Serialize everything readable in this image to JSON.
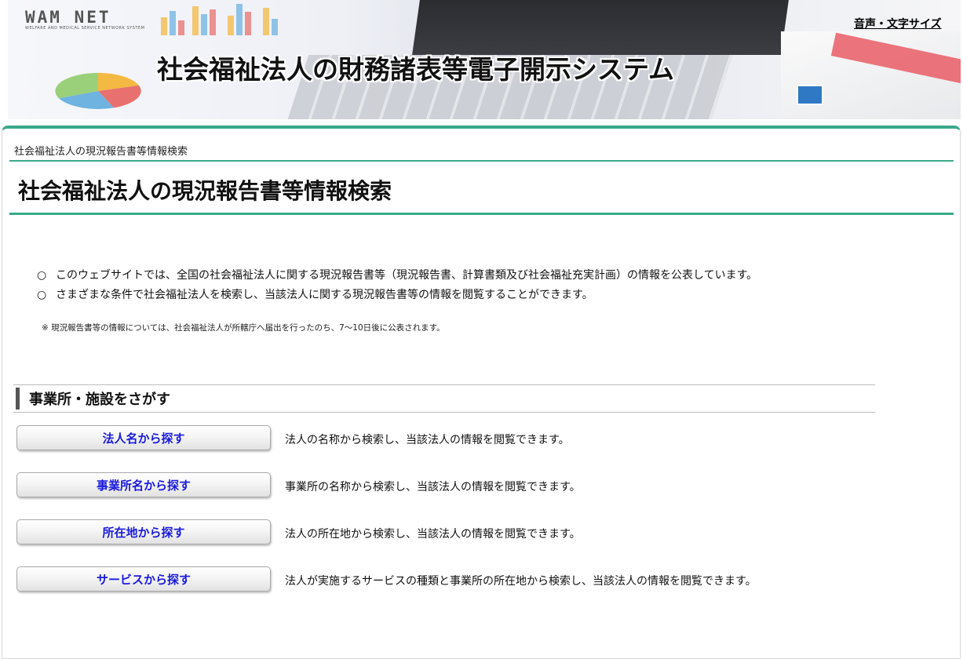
{
  "header": {
    "logo": "WAM NET",
    "logo_sub": "WELFARE AND MEDICAL SERVICE NETWORK SYSTEM",
    "system_title": "社会福祉法人の財務諸表等電子開示システム",
    "voice_text_size_link": "音声・文字サイズ"
  },
  "breadcrumb": "社会福祉法人の現況報告書等情報検索",
  "page_title": "社会福祉法人の現況報告書等情報検索",
  "intro": {
    "bullet": "○",
    "lines": [
      "このウェブサイトでは、全国の社会福祉法人に関する現況報告書等（現況報告書、計算書類及び社会福祉充実計画）の情報を公表しています。",
      "さまざまな条件で社会福祉法人を検索し、当該法人に関する現況報告書等の情報を閲覧することができます。"
    ],
    "note": "※ 現況報告書等の情報については、社会福祉法人が所轄庁へ届出を行ったのち、7〜10日後に公表されます。"
  },
  "section": {
    "title": "事業所・施設をさがす",
    "items": [
      {
        "button": "法人名から探す",
        "desc": "法人の名称から検索し、当該法人の情報を閲覧できます。"
      },
      {
        "button": "事業所名から探す",
        "desc": "事業所の名称から検索し、当該法人の情報を閲覧できます。"
      },
      {
        "button": "所在地から探す",
        "desc": "法人の所在地から検索し、当該法人の情報を閲覧できます。"
      },
      {
        "button": "サービスから探す",
        "desc": "法人が実施するサービスの種類と事業所の所在地から検索し、当該法人の情報を閲覧できます。"
      }
    ]
  }
}
